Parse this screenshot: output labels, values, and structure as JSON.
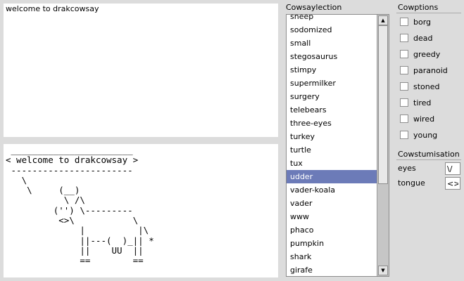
{
  "message": {
    "value": "welcome to drakcowsay"
  },
  "output": {
    "ascii": " _______________________\n< welcome to drakcowsay >\n -----------------------\n   \\\n    \\     (__)\n           \\ /\\\n         ('') \\---------\n          <>\\           \\\n              |          |\\\n              ||---(  )_|| *\n              ||    UU  ||\n              ==        =="
  },
  "cow_list": {
    "label": "Cowsaylection",
    "items": [
      "sheep",
      "sodomized",
      "small",
      "stegosaurus",
      "stimpy",
      "supermilker",
      "surgery",
      "telebears",
      "three-eyes",
      "turkey",
      "turtle",
      "tux",
      "udder",
      "vader-koala",
      "vader",
      "www",
      "phaco",
      "pumpkin",
      "shark",
      "girafe"
    ],
    "selected": "udder",
    "scroll_up_icon": "arrow-up-icon",
    "scroll_down_icon": "arrow-down-icon"
  },
  "options": {
    "label": "Cowptions",
    "items": [
      {
        "label": "borg",
        "checked": false
      },
      {
        "label": "dead",
        "checked": false
      },
      {
        "label": "greedy",
        "checked": false
      },
      {
        "label": "paranoid",
        "checked": false
      },
      {
        "label": "stoned",
        "checked": false
      },
      {
        "label": "tired",
        "checked": false
      },
      {
        "label": "wired",
        "checked": false
      },
      {
        "label": "young",
        "checked": false
      }
    ]
  },
  "costume": {
    "label": "Cowstumisation",
    "eyes_label": "eyes",
    "eyes_value": "\\/",
    "tongue_label": "tongue",
    "tongue_value": "<>"
  },
  "colors": {
    "selection": "#6c7bb8",
    "window_bg": "#dcdcdc"
  }
}
